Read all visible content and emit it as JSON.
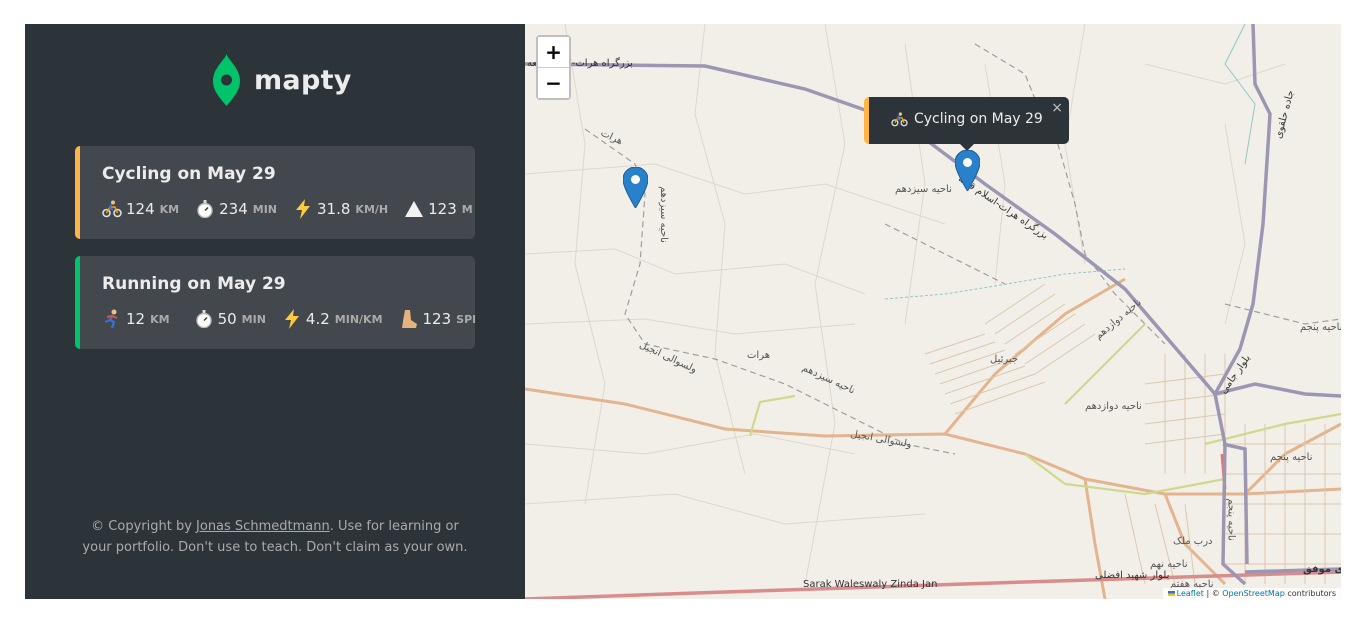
{
  "logo": {
    "name": "mapty"
  },
  "workouts": [
    {
      "type": "cycling",
      "title": "Cycling on May 29",
      "accent": "#ffb545",
      "stats": [
        {
          "icon": "cyclist-icon",
          "value": "124",
          "unit": "km"
        },
        {
          "icon": "stopwatch-icon",
          "value": "234",
          "unit": "min"
        },
        {
          "icon": "lightning-icon",
          "value": "31.8",
          "unit": "km/h"
        },
        {
          "icon": "mountain-icon",
          "value": "123",
          "unit": "m"
        }
      ]
    },
    {
      "type": "running",
      "title": "Running on May 29",
      "accent": "#00c46a",
      "stats": [
        {
          "icon": "runner-icon",
          "value": "12",
          "unit": "km"
        },
        {
          "icon": "stopwatch-icon",
          "value": "50",
          "unit": "min"
        },
        {
          "icon": "lightning-icon",
          "value": "4.2",
          "unit": "min/km"
        },
        {
          "icon": "footprint-icon",
          "value": "123",
          "unit": "spm"
        }
      ]
    }
  ],
  "copyright": {
    "prefix": "© Copyright by",
    "author": "Jonas Schmedtmann",
    "suffix": ". Use for learning or your portfolio. Don't use to teach. Don't claim as your own."
  },
  "map": {
    "zoom_in": "+",
    "zoom_out": "−",
    "popup": {
      "icon": "cyclist-icon",
      "text": "Cycling on May 29",
      "close": "×"
    },
    "labels": {
      "highway_top": "بزرگراه هرات-اسلام قلعه",
      "highway_mid": "بزرگراه هرات-اسلام قلعه",
      "herat_1": "هرات",
      "herat_2": "هرات",
      "district_13": "ناحیه سیزدهم",
      "district_13b": "ناحیه سیزدهم",
      "district_13c": "ناحیه سیزدهم",
      "district_12": "ناحیه دوازدهم",
      "district_12b": "ناحیه دوازدهم",
      "injil_1": "ولسوالی انجیل",
      "injil_2": "ولسوالی انجیل",
      "jebrail": "جبرئیل",
      "jami": "بلوار جامی",
      "district_5": "ناحیه پنجم",
      "district_5b": "ناحیه پنجم",
      "district_5c": "ناحیه پنجم",
      "dar_malek": "درب ملک",
      "district_9": "ناحیه نهم",
      "afzali": "بلوار شهید افضلی",
      "district_7": "ناحیه هفتم",
      "sarak": "Sarak Waleswaly Zinda Jan",
      "movafaq": "ی موفق",
      "ring": "جاده حلقوی"
    },
    "attribution": {
      "leaflet": "Leaflet",
      "separator": " | © ",
      "osm": "OpenStreetMap",
      "suffix": " contributors"
    }
  },
  "colors": {
    "sidebar_bg": "#2d3439",
    "card_bg": "#42484d",
    "brand_green": "#00c46a",
    "cycling_orange": "#ffb545",
    "marker_blue": "#2a81cb"
  }
}
